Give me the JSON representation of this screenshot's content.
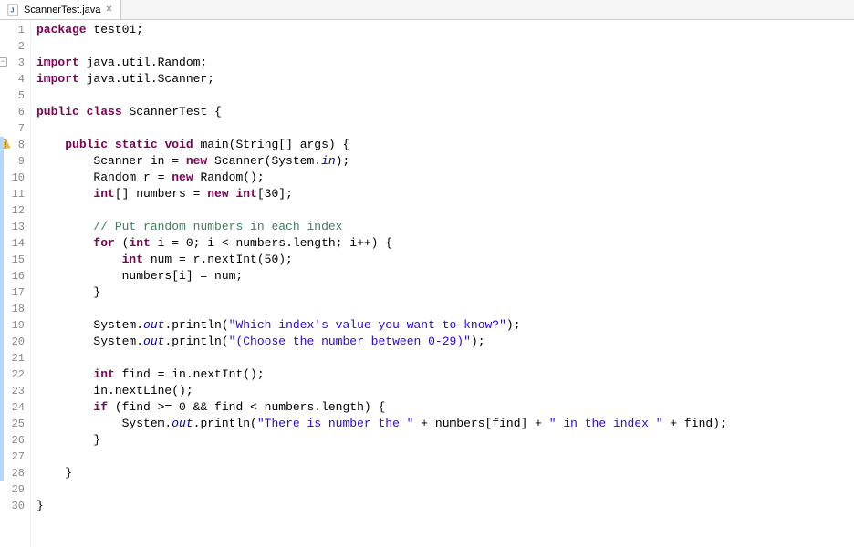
{
  "tab": {
    "filename": "ScannerTest.java"
  },
  "code": [
    {
      "n": 1,
      "tokens": [
        [
          "kw",
          "package"
        ],
        [
          "r",
          " test01;"
        ]
      ]
    },
    {
      "n": 2,
      "tokens": []
    },
    {
      "n": 3,
      "fold": true,
      "tokens": [
        [
          "kw",
          "import"
        ],
        [
          "r",
          " java.util.Random;"
        ]
      ]
    },
    {
      "n": 4,
      "tokens": [
        [
          "kw",
          "import"
        ],
        [
          "r",
          " java.util.Scanner;"
        ]
      ]
    },
    {
      "n": 5,
      "tokens": []
    },
    {
      "n": 6,
      "tokens": [
        [
          "kw",
          "public"
        ],
        [
          "r",
          " "
        ],
        [
          "kw",
          "class"
        ],
        [
          "r",
          " ScannerTest {"
        ]
      ]
    },
    {
      "n": 7,
      "tokens": []
    },
    {
      "n": 8,
      "fold": true,
      "warn": true,
      "tokens": [
        [
          "r",
          "    "
        ],
        [
          "kw",
          "public"
        ],
        [
          "r",
          " "
        ],
        [
          "kw",
          "static"
        ],
        [
          "r",
          " "
        ],
        [
          "kw",
          "void"
        ],
        [
          "r",
          " main(String[] args) {"
        ]
      ]
    },
    {
      "n": 9,
      "tokens": [
        [
          "r",
          "        Scanner in = "
        ],
        [
          "kw",
          "new"
        ],
        [
          "r",
          " Scanner(System."
        ],
        [
          "static-ital",
          "in"
        ],
        [
          "r",
          ");"
        ]
      ]
    },
    {
      "n": 10,
      "tokens": [
        [
          "r",
          "        Random r = "
        ],
        [
          "kw",
          "new"
        ],
        [
          "r",
          " Random();"
        ]
      ]
    },
    {
      "n": 11,
      "tokens": [
        [
          "r",
          "        "
        ],
        [
          "kw",
          "int"
        ],
        [
          "r",
          "[] numbers = "
        ],
        [
          "kw",
          "new"
        ],
        [
          "r",
          " "
        ],
        [
          "kw",
          "int"
        ],
        [
          "r",
          "[30];"
        ]
      ]
    },
    {
      "n": 12,
      "tokens": []
    },
    {
      "n": 13,
      "tokens": [
        [
          "r",
          "        "
        ],
        [
          "cmt",
          "// Put random numbers in each index"
        ]
      ]
    },
    {
      "n": 14,
      "tokens": [
        [
          "r",
          "        "
        ],
        [
          "kw",
          "for"
        ],
        [
          "r",
          " ("
        ],
        [
          "kw",
          "int"
        ],
        [
          "r",
          " i = 0; i < numbers.length; i++) {"
        ]
      ]
    },
    {
      "n": 15,
      "tokens": [
        [
          "r",
          "            "
        ],
        [
          "kw",
          "int"
        ],
        [
          "r",
          " num = r.nextInt(50);"
        ]
      ]
    },
    {
      "n": 16,
      "tokens": [
        [
          "r",
          "            numbers[i] = num;"
        ]
      ]
    },
    {
      "n": 17,
      "tokens": [
        [
          "r",
          "        }"
        ]
      ]
    },
    {
      "n": 18,
      "tokens": []
    },
    {
      "n": 19,
      "tokens": [
        [
          "r",
          "        System."
        ],
        [
          "static-ital",
          "out"
        ],
        [
          "r",
          ".println("
        ],
        [
          "str",
          "\"Which index's value you want to know?\""
        ],
        [
          "r",
          ");"
        ]
      ]
    },
    {
      "n": 20,
      "tokens": [
        [
          "r",
          "        System."
        ],
        [
          "static-ital",
          "out"
        ],
        [
          "r",
          ".println("
        ],
        [
          "str",
          "\"(Choose the number between 0-29)\""
        ],
        [
          "r",
          ");"
        ]
      ]
    },
    {
      "n": 21,
      "tokens": []
    },
    {
      "n": 22,
      "tokens": [
        [
          "r",
          "        "
        ],
        [
          "kw",
          "int"
        ],
        [
          "r",
          " find = in.nextInt();"
        ]
      ]
    },
    {
      "n": 23,
      "tokens": [
        [
          "r",
          "        in.nextLine();"
        ]
      ]
    },
    {
      "n": 24,
      "tokens": [
        [
          "r",
          "        "
        ],
        [
          "kw",
          "if"
        ],
        [
          "r",
          " (find >= 0 && find < numbers.length) {"
        ]
      ]
    },
    {
      "n": 25,
      "tokens": [
        [
          "r",
          "            System."
        ],
        [
          "static-ital",
          "out"
        ],
        [
          "r",
          ".println("
        ],
        [
          "str",
          "\"There is number the \""
        ],
        [
          "r",
          " + numbers[find] + "
        ],
        [
          "str",
          "\" in the index \""
        ],
        [
          "r",
          " + find);"
        ]
      ]
    },
    {
      "n": 26,
      "tokens": [
        [
          "r",
          "        }"
        ]
      ]
    },
    {
      "n": 27,
      "tokens": []
    },
    {
      "n": 28,
      "tokens": [
        [
          "r",
          "    }"
        ]
      ]
    },
    {
      "n": 29,
      "tokens": []
    },
    {
      "n": 30,
      "tokens": [
        [
          "r",
          "}"
        ]
      ]
    }
  ]
}
